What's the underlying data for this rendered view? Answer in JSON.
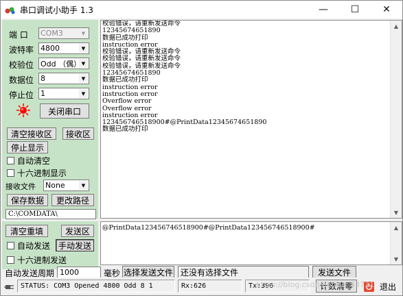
{
  "window": {
    "title": "串口调试小助手 1.3",
    "controls": [
      "—",
      "☐",
      "✕"
    ]
  },
  "settings": {
    "port_label": "端  口",
    "port_value": "COM3",
    "baud_label": "波特率",
    "baud_value": "4800",
    "parity_label": "校验位",
    "parity_value": "Odd （偶）",
    "databits_label": "数据位",
    "databits_value": "8",
    "stopbits_label": "停止位",
    "stopbits_value": "1",
    "close_port_label": "关闭串口",
    "status_led_color": "#ff0000"
  },
  "receive_controls": {
    "clear_recv_label": "清空接收区",
    "recv_area_label": "接收区",
    "stop_display_label": "停止显示",
    "auto_clear_label": "自动清空",
    "hex_display_label": "十六进制显示",
    "recv_file_label": "接收文件",
    "recv_file_value": "None",
    "save_data_label": "保存数据",
    "change_path_label": "更改路径",
    "path_value": "C:\\COMDATA\\"
  },
  "receive_lines": [
    "校验错误，请重新发送命令",
    "12345674651890",
    "数据已成功打印",
    "instruction error",
    "校验错误，请重新发送命令",
    "校验错误，请重新发送命令",
    "校验错误，请重新发送命令",
    "12345674651890",
    "数据已成功打印",
    "instruction error",
    "instruction error",
    "Overflow error",
    "Overflow error",
    "instruction error",
    "123456746518900#@PrintData12345674651890",
    "数据已成功打印"
  ],
  "send_controls": {
    "clear_resend_label": "清空重填",
    "send_area_label": "发送区",
    "auto_send_label": "自动发送",
    "manual_send_label": "手动发送",
    "hex_send_label": "十六进制发送",
    "period_label": "自动发送周期",
    "period_value": "1000",
    "ms_label": "毫秒",
    "choose_file_label": "选择发送文件",
    "file_status": "还没有选择文件",
    "send_file_label": "发送文件"
  },
  "send_text": "@PrintData123456746518900#@PrintData123456746518900#",
  "status": {
    "status_text": "STATUS: COM3 Opened 4800 Odd  8 1",
    "rx_text": "Rx:626",
    "tx_text": "Tx:396",
    "reset_count_label": "计数清零",
    "exit_label": "退出"
  },
  "watermark": "https://blog.csdn.net/qq_43731",
  "colors": {
    "panel_green": "#c7e3c7",
    "exit_icon": "#e8472f"
  }
}
